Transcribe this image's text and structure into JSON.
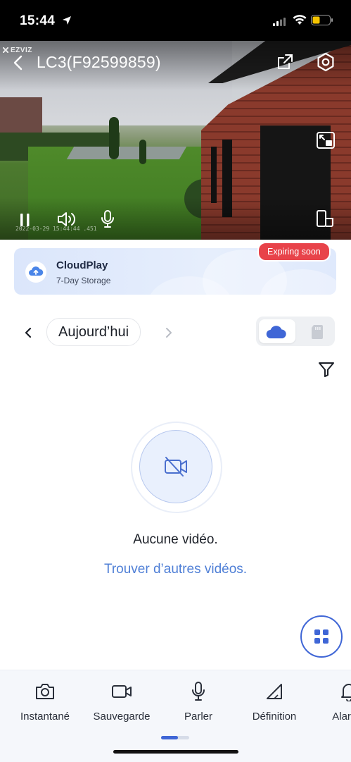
{
  "status_bar": {
    "time": "15:44"
  },
  "video": {
    "brand": "EZVIZ",
    "camera_title": "LC3(F92599859)",
    "timestamp": "2022-03-29 15:44:44 .451"
  },
  "cloud_banner": {
    "name": "CloudPlay",
    "subtitle": "7-Day Storage",
    "badge": "Expiring soon"
  },
  "date_nav": {
    "label": "Aujourd’hui"
  },
  "empty_state": {
    "message": "Aucune vidéo.",
    "link": "Trouver d’autres vidéos."
  },
  "toolbar": {
    "items": [
      {
        "label": "Instantané",
        "icon": "camera-icon"
      },
      {
        "label": "Sauvegarde",
        "icon": "video-record-icon"
      },
      {
        "label": "Parler",
        "icon": "microphone-icon"
      },
      {
        "label": "Définition",
        "icon": "definition-icon"
      },
      {
        "label": "Alarme",
        "icon": "bell-icon"
      }
    ]
  },
  "colors": {
    "accent": "#3f66d6",
    "badge": "#e8434a",
    "link": "#4f7fd6"
  }
}
